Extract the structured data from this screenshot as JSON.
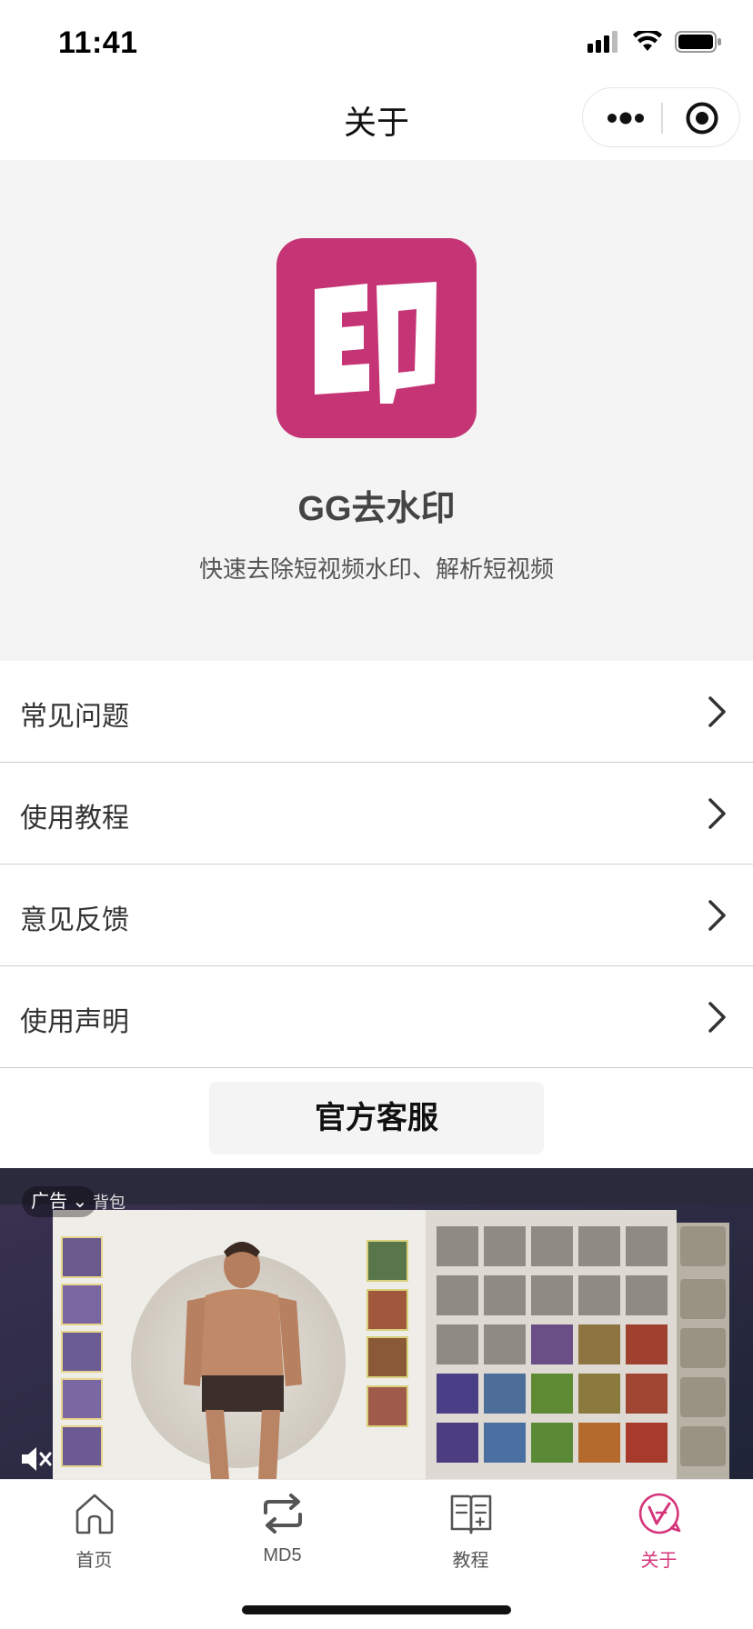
{
  "status_bar": {
    "time": "11:41"
  },
  "nav": {
    "title": "关于"
  },
  "app": {
    "name": "GG去水印",
    "description": "快速去除短视频水印、解析短视频",
    "logo_text": "印",
    "logo_color": "#c53576"
  },
  "menu": [
    {
      "label": "常见问题"
    },
    {
      "label": "使用教程"
    },
    {
      "label": "意见反馈"
    },
    {
      "label": "使用声明"
    }
  ],
  "service_button": {
    "label": "官方客服"
  },
  "ad": {
    "badge": "广告",
    "bag_label": "背包"
  },
  "tabbar": [
    {
      "label": "首页",
      "icon": "home-icon"
    },
    {
      "label": "MD5",
      "icon": "repeat-icon"
    },
    {
      "label": "教程",
      "icon": "book-icon"
    },
    {
      "label": "关于",
      "icon": "about-icon",
      "active": true
    }
  ],
  "colors": {
    "accent": "#d5357a"
  }
}
